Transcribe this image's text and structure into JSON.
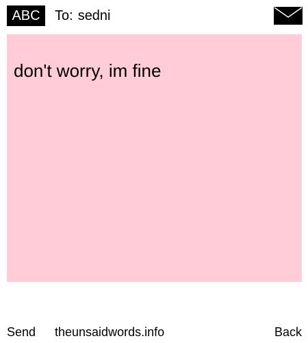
{
  "header": {
    "mode_label": "ABC",
    "recipient_prefix": "To:",
    "recipient_name": "sedni"
  },
  "message": {
    "text": "don't worry, im fine",
    "background_color": "#ffccd8"
  },
  "icons": {
    "envelope": "envelope-icon"
  },
  "footer": {
    "send_label": "Send",
    "site_label": "theunsaidwords.info",
    "back_label": "Back"
  }
}
